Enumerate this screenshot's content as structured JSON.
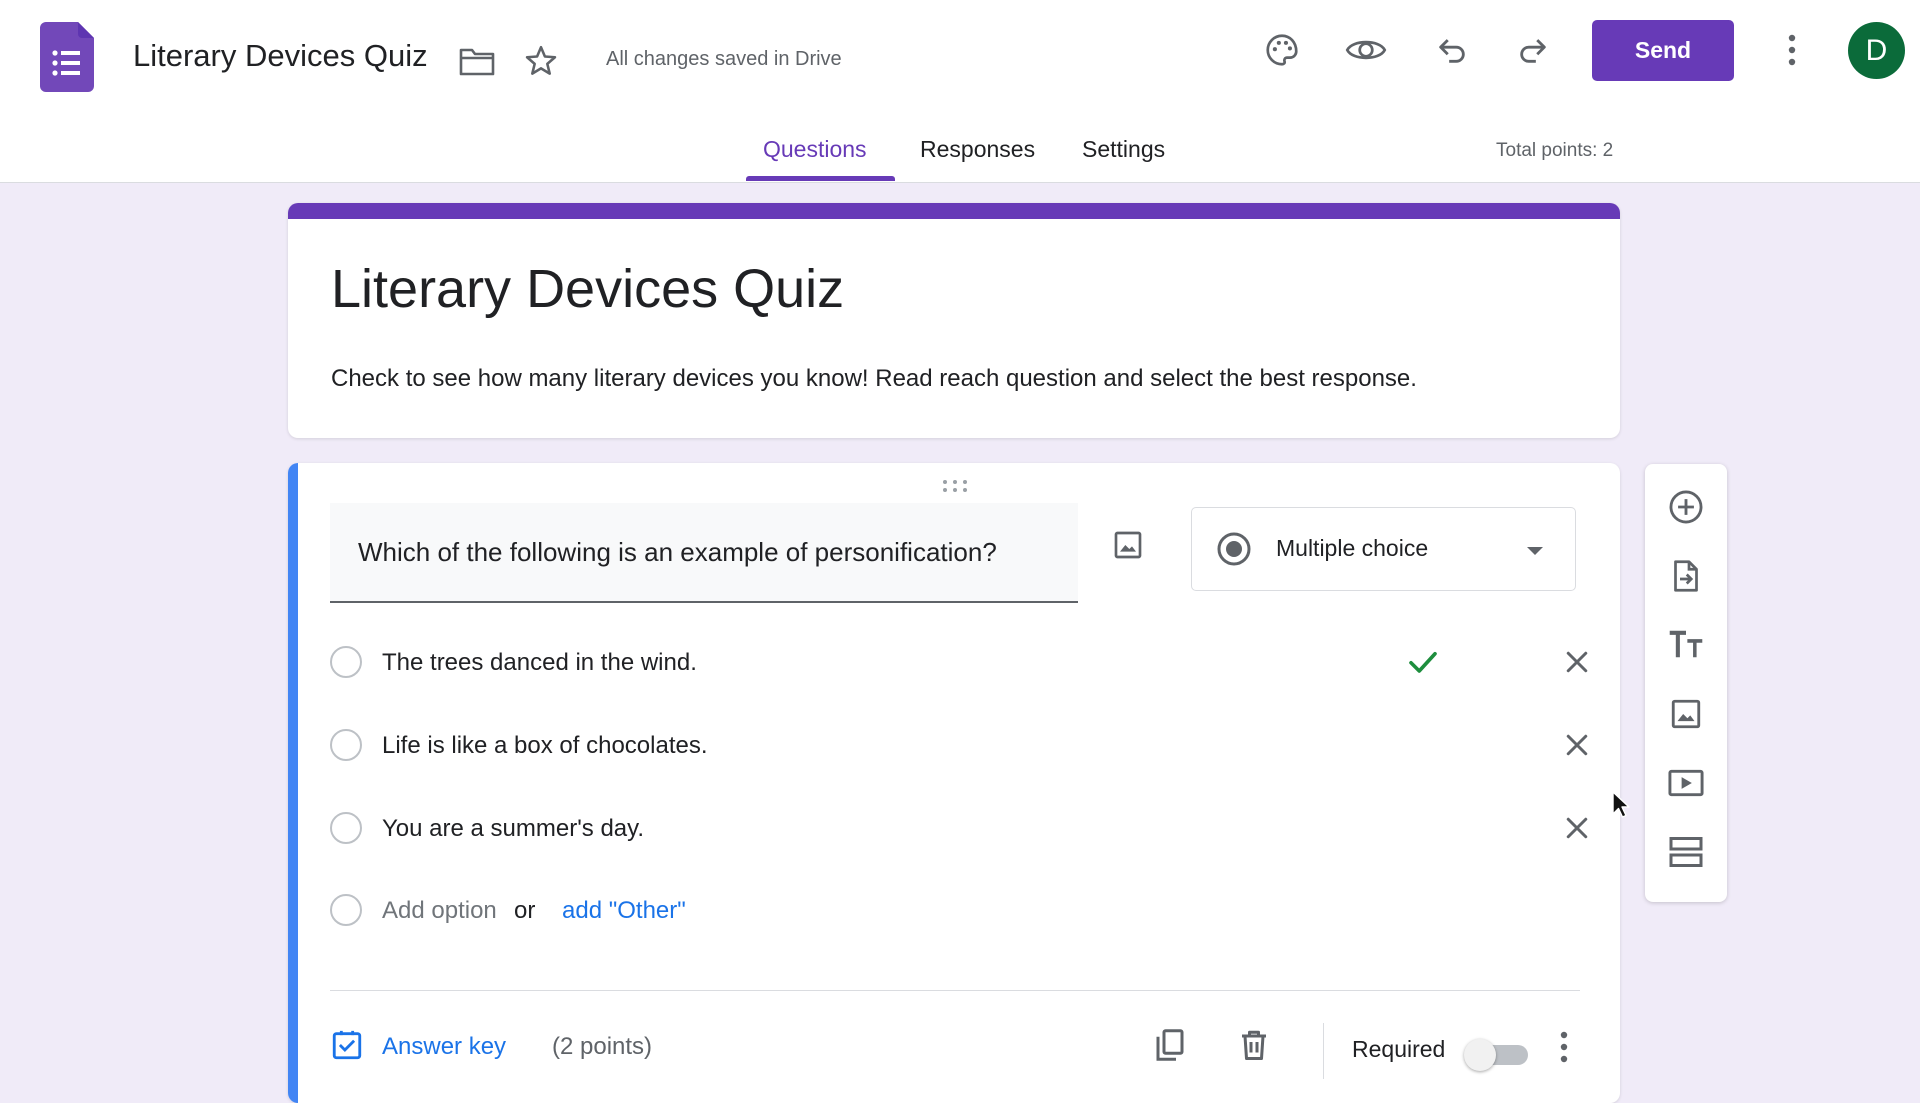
{
  "header": {
    "doc_title": "Literary Devices Quiz",
    "save_status": "All changes saved in Drive",
    "send_label": "Send",
    "avatar_initial": "D",
    "icons": [
      "forms-logo-icon",
      "folder-icon",
      "star-icon",
      "palette-icon",
      "preview-eye-icon",
      "undo-icon",
      "redo-icon",
      "more-vert-icon"
    ]
  },
  "tabs": [
    {
      "label": "Questions",
      "active": true
    },
    {
      "label": "Responses",
      "active": false
    },
    {
      "label": "Settings",
      "active": false
    }
  ],
  "total_points": "Total points: 2",
  "form": {
    "title": "Literary Devices Quiz",
    "description": "Check to see how many literary devices you know! Read reach question and select the best response."
  },
  "question": {
    "text": "Which of the following is an example of personification?",
    "type": "Multiple choice",
    "options": [
      {
        "label": "The trees danced in the wind.",
        "correct": true
      },
      {
        "label": "Life is like a box of chocolates.",
        "correct": false
      },
      {
        "label": "You are a summer's day.",
        "correct": false
      }
    ],
    "add_option": "Add option",
    "or": "or",
    "add_other": "add \"Other\"",
    "answer_key": "Answer key",
    "points": "(2 points)",
    "required_label": "Required",
    "required": false
  },
  "side_toolbar": [
    "add-question-icon",
    "import-questions-icon",
    "add-title-icon",
    "add-image-icon",
    "add-video-icon",
    "add-section-icon"
  ],
  "colors": {
    "brand": "#673ab7",
    "background": "#f0ebf8",
    "active_question": "#4285f4",
    "link": "#1a73e8",
    "correct_check": "#1e8e3e",
    "avatar": "#0b6b3a"
  }
}
